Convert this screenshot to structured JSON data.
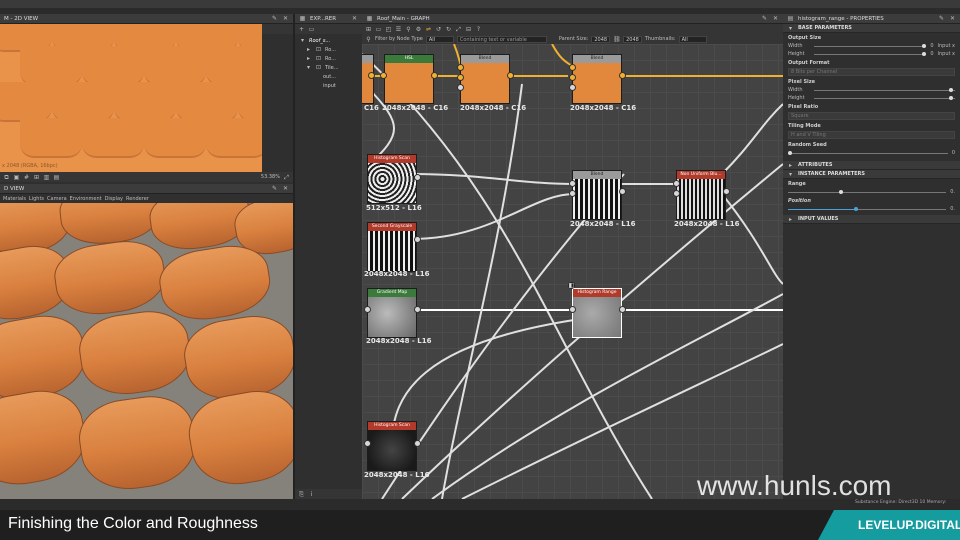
{
  "menubar": {
    "items": [
      "",
      "",
      "",
      ""
    ]
  },
  "view2d": {
    "title": "M - 2D VIEW",
    "status": "x 2048 (RGBA, 16bpc)",
    "zoom": "53.38%"
  },
  "view3d": {
    "title": "D VIEW",
    "menu": [
      "Materials",
      "Lights",
      "Camera",
      "Environment",
      "Display",
      "Renderer"
    ]
  },
  "explorer": {
    "title": "EXP...RER",
    "tree": [
      {
        "label": "Roof_s...",
        "depth": 0
      },
      {
        "label": "Ro...",
        "depth": 1
      },
      {
        "label": "Ro...",
        "depth": 1
      },
      {
        "label": "Tile...",
        "depth": 1
      },
      {
        "label": "out...",
        "depth": 2
      },
      {
        "label": "input",
        "depth": 2
      }
    ]
  },
  "graph": {
    "title": "Roof_Main - GRAPH",
    "filter": {
      "label": "Filter by Node Type",
      "value": "All"
    },
    "search": {
      "placeholder": "Containing text or variable"
    },
    "parent_size": {
      "label": "Parent Size:",
      "w": "2048",
      "h": "2048"
    },
    "thumbnails": {
      "label": "Thumbnails:",
      "value": "All"
    },
    "nodes": [
      {
        "id": "hsl",
        "title": "HSL",
        "color": "#3a7a3a",
        "label": "2048x2048 - C16",
        "thumb": "orange"
      },
      {
        "id": "blend1",
        "title": "Blend",
        "color": "#9a9a9a",
        "label": "2048x2048 - C16",
        "thumb": "orange"
      },
      {
        "id": "blend2",
        "title": "Blend",
        "color": "#9a9a9a",
        "label": "2048x2048 - C16",
        "thumb": "orange"
      },
      {
        "id": "histscan1",
        "title": "Histogram Scan",
        "color": "#b23a2a",
        "label": "512x512 - L16",
        "thumb": "noise"
      },
      {
        "id": "blend3",
        "title": "Blend",
        "color": "#9a9a9a",
        "label": "2048x2048 - L16",
        "thumb": "stripes"
      },
      {
        "id": "nonuniform",
        "title": "Non Uniform Blu...",
        "color": "#b23a2a",
        "label": "2048x2048 - L16",
        "thumb": "stripes"
      },
      {
        "id": "grayscale",
        "title": "Second Grayscale",
        "color": "#b23a2a",
        "label": "2048x2048 - L16",
        "thumb": "stripes"
      },
      {
        "id": "gradient",
        "title": "Gradient Map",
        "color": "#3a7a3a",
        "label": "2048x2048 - L16",
        "thumb": "gray"
      },
      {
        "id": "histrange",
        "title": "Histogram Range",
        "color": "#b23a2a",
        "label": "2048x2048 - L16",
        "thumb": "gray"
      },
      {
        "id": "histscan2",
        "title": "Histogram Scan",
        "color": "#b23a2a",
        "label": "2048x2048 - L16",
        "thumb": "dark"
      }
    ],
    "partial_label": "C16"
  },
  "properties": {
    "title": "histogram_range - PROPERTIES",
    "sections": {
      "base": "BASE PARAMETERS",
      "attributes": "ATTRIBUTES",
      "instance": "INSTANCE PARAMETERS",
      "input_values": "INPUT VALUES"
    },
    "output_size": {
      "label": "Output Size",
      "width": "Width",
      "height": "Height",
      "w_value": "0",
      "h_value": "0",
      "w_mode": "Input x",
      "h_mode": "Input x"
    },
    "output_format": {
      "label": "Output Format",
      "value": "8 Bits per Channel"
    },
    "pixel_size": {
      "label": "Pixel Size",
      "width": "Width",
      "height": "Height"
    },
    "pixel_ratio": {
      "label": "Pixel Ratio",
      "value": "Square"
    },
    "tiling_mode": {
      "label": "Tiling Mode",
      "value": "H and V Tiling"
    },
    "random_seed": {
      "label": "Random Seed",
      "value": "0"
    },
    "range": {
      "label": "Range",
      "value": "0.",
      "level": 0.32
    },
    "position": {
      "label": "Position",
      "value": "0.",
      "level": 0.42
    }
  },
  "status": {
    "engine": "Substance Engine: Direct3D 10  Memory:"
  },
  "caption": "Finishing the Color and Roughness",
  "watermark": "www.hunls.com",
  "brand": "LEVELUP.DIGITAL",
  "colors": {
    "accent": "#159c9f",
    "wire_yellow": "#f0b030",
    "graph_bg": "#434343"
  }
}
